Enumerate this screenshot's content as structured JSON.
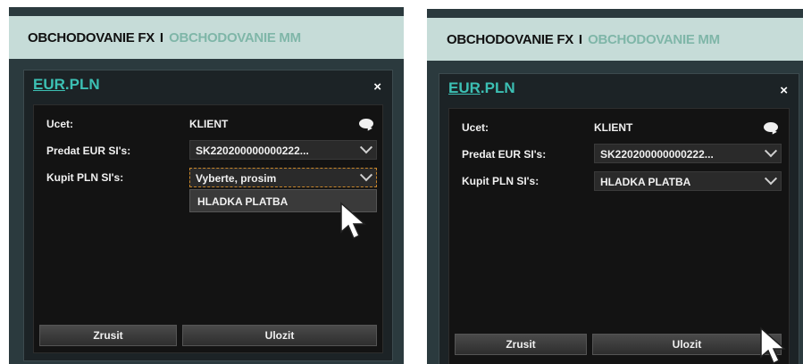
{
  "tabs": {
    "active": "OBCHODOVANIE FX",
    "separator": "I",
    "inactive": "OBCHODOVANIE MM"
  },
  "window": {
    "title_base": "EUR",
    "title_rest": ".PLN",
    "close": "×",
    "account_label": "Ucet:",
    "account_value": "KLIENT",
    "sell_label": "Predat EUR SI's:",
    "sell_value": "SK220200000000222...",
    "buy_label": "Kupit PLN SI's:",
    "cancel_label": "Zrusit",
    "save_label": "Ulozit"
  },
  "left": {
    "buy_value": "Vyberte, prosim",
    "dropdown_option": "HLADKA PLATBA"
  },
  "right": {
    "buy_value": "HLADKA PLATBA"
  },
  "colors": {
    "tabbar": "#c6dcd8",
    "accent": "#3cc0b4",
    "panel": "#2b3a3e"
  }
}
